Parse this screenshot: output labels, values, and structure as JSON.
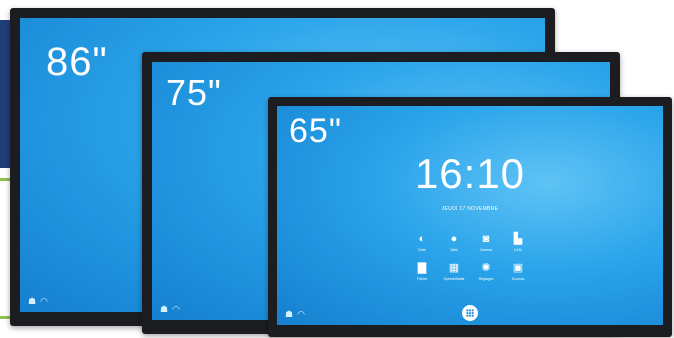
{
  "colors": {
    "background_band": "#1f3f78",
    "accent_line": "#8bc34a",
    "bezel": "#1b1d21",
    "screen_blue": "#29a3ea"
  },
  "displays": [
    {
      "size_label": "86\""
    },
    {
      "size_label": "75\""
    },
    {
      "size_label": "65\"",
      "clock": "16:10",
      "date": "JEUDI 17 NOVEMBRE",
      "apps": [
        {
          "label": "Note",
          "icon": "note-icon"
        },
        {
          "label": "Web",
          "icon": "globe-icon"
        },
        {
          "label": "Caméra",
          "icon": "camera-icon"
        },
        {
          "label": "ULM",
          "icon": "robot-icon"
        },
        {
          "label": "Fichier",
          "icon": "folder-icon"
        },
        {
          "label": "Speechifiable",
          "icon": "chart-icon"
        },
        {
          "label": "Réglages",
          "icon": "gear-icon"
        },
        {
          "label": "Sources",
          "icon": "sources-icon"
        }
      ]
    }
  ]
}
